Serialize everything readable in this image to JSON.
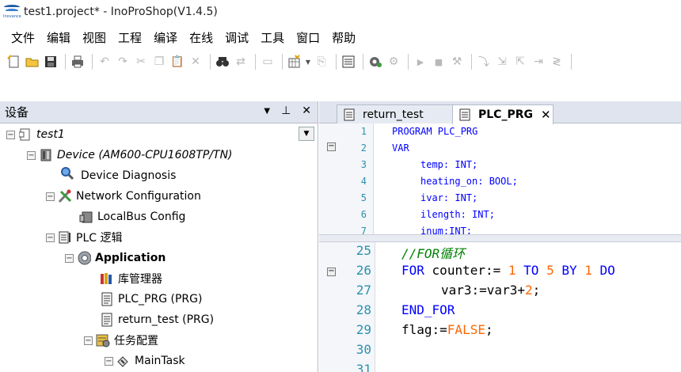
{
  "window": {
    "title": "test1.project* - InoProShop(V1.4.5)",
    "logo_text": "Inovance"
  },
  "menu": [
    "文件",
    "编辑",
    "视图",
    "工程",
    "编译",
    "在线",
    "调试",
    "工具",
    "窗口",
    "帮助"
  ],
  "toolbar": {
    "icons": [
      "new-project-icon",
      "open-icon",
      "save-icon",
      "print-icon",
      "undo-icon",
      "redo-icon",
      "cut-icon",
      "copy-icon",
      "paste-icon",
      "delete-icon",
      "find-icon",
      "replace-icon",
      "bookmark-icon",
      "add-object-icon",
      "dropdown-icon",
      "export-icon",
      "build-icon",
      "login-icon",
      "logout-icon",
      "run-icon",
      "stop-icon",
      "reset-icon",
      "step-over-icon",
      "step-into-icon",
      "step-out-icon",
      "breakpoint-icon",
      "arrow-icon"
    ]
  },
  "devices_panel": {
    "title": "设备",
    "tree": [
      {
        "label": "test1"
      },
      {
        "label": "Device (AM600-CPU1608TP/TN)"
      },
      {
        "label": "Device Diagnosis"
      },
      {
        "label": "Network Configuration"
      },
      {
        "label": "LocalBus Config"
      },
      {
        "label": "PLC 逻辑"
      },
      {
        "label": "Application"
      },
      {
        "label": "库管理器"
      },
      {
        "label": "PLC_PRG (PRG)"
      },
      {
        "label": "return_test (PRG)"
      },
      {
        "label": "任务配置"
      },
      {
        "label": "MainTask"
      }
    ]
  },
  "editor": {
    "tabs": [
      {
        "label": "return_test"
      },
      {
        "label": "PLC_PRG"
      }
    ],
    "declarations": [
      {
        "line": "1",
        "text": "PROGRAM PLC_PRG"
      },
      {
        "line": "2",
        "text": "VAR"
      },
      {
        "line": "3",
        "text": "temp: INT;"
      },
      {
        "line": "4",
        "text": "heating_on: BOOL;"
      },
      {
        "line": "5",
        "text": "ivar: INT;"
      },
      {
        "line": "6",
        "text": "ilength: INT;"
      },
      {
        "line": "7",
        "text": "inum:INT;"
      }
    ],
    "body": [
      {
        "line": "25",
        "text": "//FOR循环"
      },
      {
        "line": "26",
        "text": "FOR counter:= 1 TO 5 BY 1 DO"
      },
      {
        "line": "27",
        "text": "var3:=var3+2;"
      },
      {
        "line": "28",
        "text": "END_FOR"
      },
      {
        "line": "29",
        "text": "flag:=FALSE;"
      },
      {
        "line": "30",
        "text": ""
      },
      {
        "line": "31",
        "text": ""
      }
    ]
  }
}
